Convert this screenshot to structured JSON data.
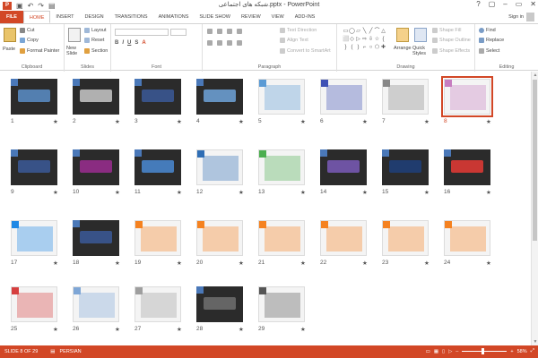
{
  "window": {
    "title": "شبکه های اجتماعی.pptx - PowerPoint",
    "logo": "P",
    "controls": [
      "?",
      "▢",
      "–",
      "▭",
      "✕"
    ]
  },
  "quick_access": [
    "save-icon",
    "undo-icon",
    "redo-icon",
    "start-from-beginning-icon"
  ],
  "tabs": [
    {
      "label": "FILE",
      "kind": "file"
    },
    {
      "label": "HOME",
      "kind": "active"
    },
    {
      "label": "INSERT",
      "kind": ""
    },
    {
      "label": "DESIGN",
      "kind": ""
    },
    {
      "label": "TRANSITIONS",
      "kind": ""
    },
    {
      "label": "ANIMATIONS",
      "kind": ""
    },
    {
      "label": "SLIDE SHOW",
      "kind": ""
    },
    {
      "label": "REVIEW",
      "kind": ""
    },
    {
      "label": "VIEW",
      "kind": ""
    },
    {
      "label": "ADD-INS",
      "kind": ""
    }
  ],
  "signin": "Sign in",
  "ribbon": {
    "clipboard": {
      "paste": "Paste",
      "cut": "Cut",
      "copy": "Copy",
      "format_painter": "Format Painter",
      "label": "Clipboard"
    },
    "slides": {
      "new_slide": "New Slide",
      "layout": "Layout",
      "reset": "Reset",
      "section": "Section",
      "label": "Slides"
    },
    "font": {
      "label": "Font"
    },
    "paragraph": {
      "text_direction": "Text Direction",
      "align_text": "Align Text",
      "convert_smartart": "Convert to SmartArt",
      "label": "Paragraph"
    },
    "drawing": {
      "arrange": "Arrange",
      "quick_styles": "Quick Styles",
      "shape_fill": "Shape Fill",
      "shape_outline": "Shape Outline",
      "shape_effects": "Shape Effects",
      "label": "Drawing",
      "shape_glyphs": [
        "▭",
        "◯",
        "▱",
        "╲",
        "╱",
        "⌒",
        "△",
        "⬜",
        "◇",
        "▷",
        "⇨",
        "⇩",
        "☆",
        "{",
        "}",
        "(",
        ")",
        "⌐",
        "○",
        "⬠",
        "✚"
      ]
    },
    "editing": {
      "find": "Find",
      "replace": "Replace",
      "select": "Select",
      "label": "Editing"
    }
  },
  "slides": [
    {
      "num": "1",
      "theme": "dark",
      "accent": "#5a8ec8"
    },
    {
      "num": "2",
      "theme": "dark",
      "accent": "#c8c8c8"
    },
    {
      "num": "3",
      "theme": "dark",
      "accent": "#3b5998"
    },
    {
      "num": "4",
      "theme": "dark",
      "accent": "#6fa3d9"
    },
    {
      "num": "5",
      "theme": "light",
      "accent": "#5b9bd5"
    },
    {
      "num": "6",
      "theme": "light",
      "accent": "#3f51b5"
    },
    {
      "num": "7",
      "theme": "light",
      "accent": "#888888"
    },
    {
      "num": "8",
      "theme": "light",
      "accent": "#c77dc0",
      "selected": true
    },
    {
      "num": "9",
      "theme": "dark",
      "accent": "#3b5998"
    },
    {
      "num": "10",
      "theme": "dark",
      "accent": "#9b2d91"
    },
    {
      "num": "11",
      "theme": "dark",
      "accent": "#4a8ad4"
    },
    {
      "num": "12",
      "theme": "light",
      "accent": "#2f6eb5"
    },
    {
      "num": "13",
      "theme": "light",
      "accent": "#4caf50"
    },
    {
      "num": "14",
      "theme": "dark",
      "accent": "#7a5bb8"
    },
    {
      "num": "15",
      "theme": "dark",
      "accent": "#1e3f7a"
    },
    {
      "num": "16",
      "theme": "dark",
      "accent": "#e53935"
    },
    {
      "num": "17",
      "theme": "light",
      "accent": "#1e88e5"
    },
    {
      "num": "18",
      "theme": "dark",
      "accent": "#3b5998"
    },
    {
      "num": "19",
      "theme": "light",
      "accent": "#f58220"
    },
    {
      "num": "20",
      "theme": "light",
      "accent": "#f58220"
    },
    {
      "num": "21",
      "theme": "light",
      "accent": "#f58220"
    },
    {
      "num": "22",
      "theme": "light",
      "accent": "#f58220"
    },
    {
      "num": "23",
      "theme": "light",
      "accent": "#f58220"
    },
    {
      "num": "24",
      "theme": "light",
      "accent": "#f58220"
    },
    {
      "num": "25",
      "theme": "light",
      "accent": "#d63f3f"
    },
    {
      "num": "26",
      "theme": "light",
      "accent": "#7ea6d6"
    },
    {
      "num": "27",
      "theme": "light",
      "accent": "#9e9e9e"
    },
    {
      "num": "28",
      "theme": "dark",
      "accent": "#707070"
    },
    {
      "num": "29",
      "theme": "light",
      "accent": "#555555"
    }
  ],
  "star": "★",
  "status": {
    "slide": "SLIDE 8 OF 29",
    "language": "PERSIAN",
    "zoom": "58%",
    "zoom_out": "–",
    "zoom_in": "+"
  }
}
